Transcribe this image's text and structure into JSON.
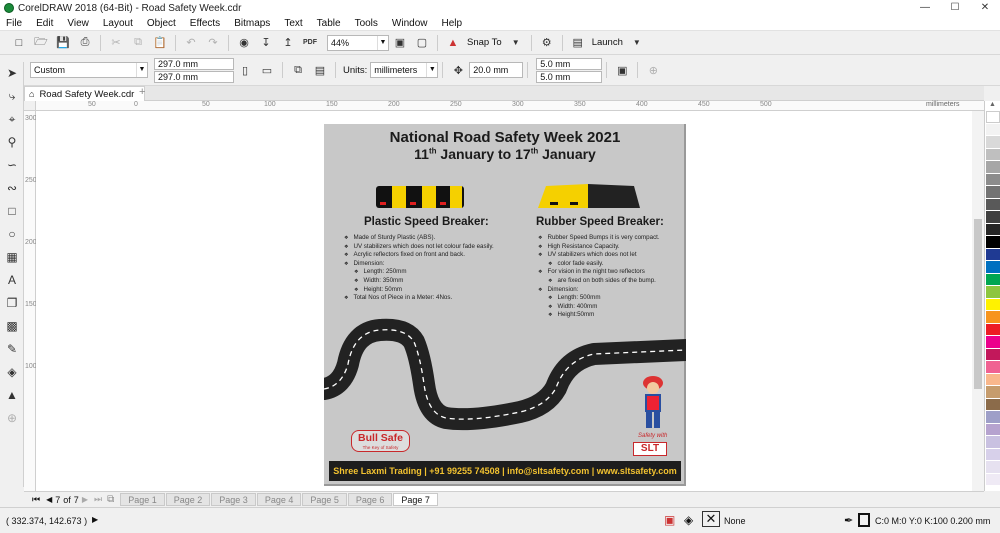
{
  "window": {
    "title": "CorelDRAW 2018 (64-Bit) - Road Safety Week.cdr",
    "minimize": "—",
    "maximize": "☐",
    "close": "✕"
  },
  "menu": [
    "File",
    "Edit",
    "View",
    "Layout",
    "Object",
    "Effects",
    "Bitmaps",
    "Text",
    "Table",
    "Tools",
    "Window",
    "Help"
  ],
  "standard_toolbar": {
    "zoom": "44%",
    "snap_to": "Snap To",
    "launch": "Launch",
    "pdf_label": "PDF"
  },
  "property_bar": {
    "page_preset": "Custom",
    "width": "297.0 mm",
    "height": "297.0 mm",
    "units_label": "Units:",
    "units": "millimeters",
    "nudge": "20.0 mm",
    "dup_x": "5.0 mm",
    "dup_y": "5.0 mm"
  },
  "document_tab": "Road Safety Week.cdr",
  "ruler": {
    "h_ticks": [
      "50",
      "0",
      "50",
      "100",
      "150",
      "200",
      "250",
      "300",
      "350",
      "400",
      "450",
      "500"
    ],
    "h_units": "millimeters",
    "v_ticks": [
      "300",
      "250",
      "200",
      "150",
      "100"
    ]
  },
  "page_nav": {
    "current": "7",
    "of_label": "of",
    "total": "7",
    "pages": [
      "Page 1",
      "Page 2",
      "Page 3",
      "Page 4",
      "Page 5",
      "Page 6",
      "Page 7"
    ]
  },
  "status": {
    "coords": "( 332.374, 142.673 )",
    "fill": "None",
    "outline": "C:0 M:0 Y:0 K:100  0.200 mm"
  },
  "palette_colors": [
    "#ffffff",
    "#f2f2f2",
    "#d9d9d9",
    "#bfbfbf",
    "#a6a6a6",
    "#8c8c8c",
    "#737373",
    "#595959",
    "#404040",
    "#262626",
    "#000000",
    "#1f3a93",
    "#0070c0",
    "#00a651",
    "#8dc63f",
    "#fff200",
    "#f7941d",
    "#ed1c24",
    "#ec008c",
    "#c2185b",
    "#f06292",
    "#f9b78c",
    "#c69c6d",
    "#8b6b4a",
    "#9e9fc8",
    "#b6a3cf",
    "#c9c1e1",
    "#d7d0ea",
    "#e6e1f0",
    "#efeaf5"
  ],
  "poster": {
    "title_line1": "National Road Safety Week 2021",
    "title_line2_a": "11",
    "title_line2_sup1": "th",
    "title_line2_b": " January to 17",
    "title_line2_sup2": "th",
    "title_line2_c": " January",
    "left_heading": "Plastic Speed Breaker:",
    "left_items": [
      {
        "text": "Made of Sturdy Plastic (ABS).",
        "sub": false
      },
      {
        "text": "UV stabilizers which does not let colour fade easily.",
        "sub": false
      },
      {
        "text": "Acrylic reflectors fixed on front and back.",
        "sub": false
      },
      {
        "text": "Dimension:",
        "sub": false
      },
      {
        "text": "Length: 250mm",
        "sub": true
      },
      {
        "text": "Width: 350mm",
        "sub": true
      },
      {
        "text": "Height: 50mm",
        "sub": true
      },
      {
        "text": "Total Nos of Piece in a Meter: 4Nos.",
        "sub": false
      }
    ],
    "right_heading": "Rubber Speed Breaker:",
    "right_items": [
      {
        "text": "Rubber Speed Bumps it is very compact.",
        "sub": false
      },
      {
        "text": "High Resistance Capacity.",
        "sub": false
      },
      {
        "text": "UV stabilizers which does not let",
        "sub": false
      },
      {
        "text": "color fade easily.",
        "sub": true
      },
      {
        "text": "For vision in the night two reflectors",
        "sub": false
      },
      {
        "text": "are fixed on both sides of the bump.",
        "sub": true
      },
      {
        "text": "Dimension:",
        "sub": false
      },
      {
        "text": "Length: 500mm",
        "sub": true
      },
      {
        "text": "Width: 400mm",
        "sub": true
      },
      {
        "text": "Height:50mm",
        "sub": true
      }
    ],
    "logo_name": "Bull Safe",
    "logo_tagline": "The Key of Safety",
    "safety_with": "Safety with",
    "slt": "SLT",
    "footer": "Shree Laxmi Trading | +91 99255 74508 | info@sltsafety.com | www.sltsafety.com"
  }
}
